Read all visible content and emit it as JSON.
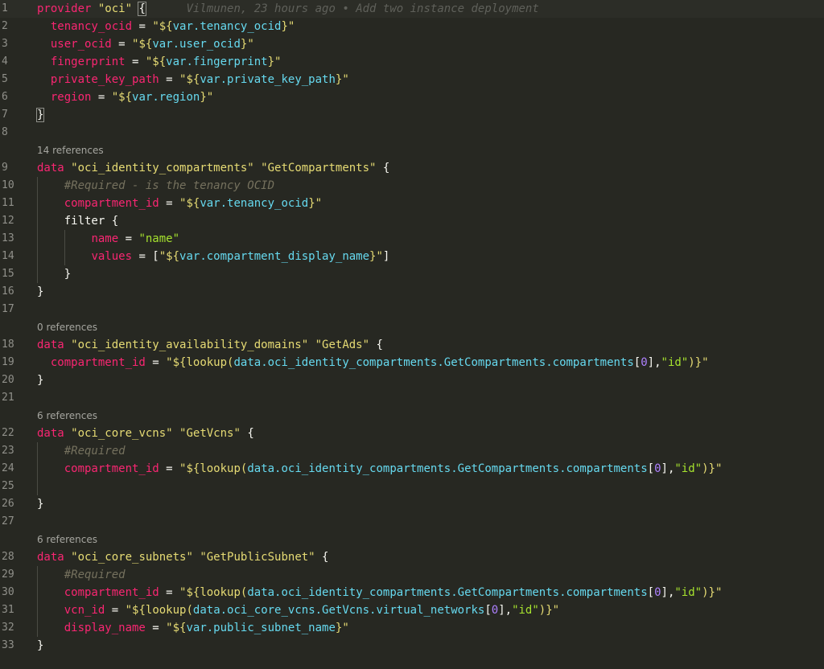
{
  "editor": {
    "blame": "Vilmunen, 23 hours ago • Add two instance deployment",
    "lines": [
      {
        "n": "1",
        "t": [
          [
            "kw",
            "provider"
          ],
          [
            "plain",
            " "
          ],
          [
            "str",
            "\"oci\""
          ],
          [
            "plain",
            " "
          ],
          [
            "match",
            "{"
          ]
        ]
      },
      {
        "n": "2",
        "t": [
          [
            "plain",
            "  "
          ],
          [
            "attr",
            "tenancy_ocid"
          ],
          [
            "plain",
            " = "
          ],
          [
            "str",
            "\"${"
          ],
          [
            "var",
            "var.tenancy_ocid"
          ],
          [
            "str",
            "}\""
          ]
        ]
      },
      {
        "n": "3",
        "t": [
          [
            "plain",
            "  "
          ],
          [
            "attr",
            "user_ocid"
          ],
          [
            "plain",
            " = "
          ],
          [
            "str",
            "\"${"
          ],
          [
            "var",
            "var.user_ocid"
          ],
          [
            "str",
            "}\""
          ]
        ]
      },
      {
        "n": "4",
        "t": [
          [
            "plain",
            "  "
          ],
          [
            "attr",
            "fingerprint"
          ],
          [
            "plain",
            " = "
          ],
          [
            "str",
            "\"${"
          ],
          [
            "var",
            "var.fingerprint"
          ],
          [
            "str",
            "}\""
          ]
        ]
      },
      {
        "n": "5",
        "t": [
          [
            "plain",
            "  "
          ],
          [
            "attr",
            "private_key_path"
          ],
          [
            "plain",
            " = "
          ],
          [
            "str",
            "\"${"
          ],
          [
            "var",
            "var.private_key_path"
          ],
          [
            "str",
            "}\""
          ]
        ]
      },
      {
        "n": "6",
        "t": [
          [
            "plain",
            "  "
          ],
          [
            "attr",
            "region"
          ],
          [
            "plain",
            " = "
          ],
          [
            "str",
            "\"${"
          ],
          [
            "var",
            "var.region"
          ],
          [
            "str",
            "}\""
          ]
        ]
      },
      {
        "n": "7",
        "t": [
          [
            "match",
            "}"
          ]
        ]
      },
      {
        "n": "8",
        "t": []
      },
      {
        "n": "9",
        "t": [
          [
            "kw",
            "data"
          ],
          [
            "plain",
            " "
          ],
          [
            "str",
            "\"oci_identity_compartments\""
          ],
          [
            "plain",
            " "
          ],
          [
            "str",
            "\"GetCompartments\""
          ],
          [
            "plain",
            " {"
          ]
        ]
      },
      {
        "n": "10",
        "t": [
          [
            "plain",
            "    "
          ],
          [
            "cmt",
            "#Required - is the tenancy OCID"
          ]
        ]
      },
      {
        "n": "11",
        "t": [
          [
            "plain",
            "    "
          ],
          [
            "attr",
            "compartment_id"
          ],
          [
            "plain",
            " = "
          ],
          [
            "str",
            "\"${"
          ],
          [
            "var",
            "var.tenancy_ocid"
          ],
          [
            "str",
            "}\""
          ]
        ]
      },
      {
        "n": "12",
        "t": [
          [
            "plain",
            "    filter {"
          ]
        ]
      },
      {
        "n": "13",
        "t": [
          [
            "plain",
            "        "
          ],
          [
            "attr",
            "name"
          ],
          [
            "plain",
            " = "
          ],
          [
            "strc",
            "\"name\""
          ]
        ]
      },
      {
        "n": "14",
        "t": [
          [
            "plain",
            "        "
          ],
          [
            "attr",
            "values"
          ],
          [
            "plain",
            " = ["
          ],
          [
            "str",
            "\"${"
          ],
          [
            "var",
            "var.compartment_display_name"
          ],
          [
            "str",
            "}\""
          ],
          [
            "plain",
            "]"
          ]
        ]
      },
      {
        "n": "15",
        "t": [
          [
            "plain",
            "    }"
          ]
        ]
      },
      {
        "n": "16",
        "t": [
          [
            "plain",
            "}"
          ]
        ]
      },
      {
        "n": "17",
        "t": []
      },
      {
        "n": "18",
        "t": [
          [
            "kw",
            "data"
          ],
          [
            "plain",
            " "
          ],
          [
            "str",
            "\"oci_identity_availability_domains\""
          ],
          [
            "plain",
            " "
          ],
          [
            "str",
            "\"GetAds\""
          ],
          [
            "plain",
            " {"
          ]
        ]
      },
      {
        "n": "19",
        "t": [
          [
            "plain",
            "  "
          ],
          [
            "attr",
            "compartment_id"
          ],
          [
            "plain",
            " = "
          ],
          [
            "str",
            "\"${"
          ],
          [
            "fn",
            "lookup("
          ],
          [
            "var",
            "data.oci_identity_compartments.GetCompartments.compartments"
          ],
          [
            "plain",
            "["
          ],
          [
            "num",
            "0"
          ],
          [
            "plain",
            "],"
          ],
          [
            "strc",
            "\"id\""
          ],
          [
            "fn",
            ")"
          ],
          [
            "str",
            "}\""
          ]
        ]
      },
      {
        "n": "20",
        "t": [
          [
            "plain",
            "}"
          ]
        ]
      },
      {
        "n": "21",
        "t": []
      },
      {
        "n": "22",
        "t": [
          [
            "kw",
            "data"
          ],
          [
            "plain",
            " "
          ],
          [
            "str",
            "\"oci_core_vcns\""
          ],
          [
            "plain",
            " "
          ],
          [
            "str",
            "\"GetVcns\""
          ],
          [
            "plain",
            " {"
          ]
        ]
      },
      {
        "n": "23",
        "t": [
          [
            "plain",
            "    "
          ],
          [
            "cmt",
            "#Required"
          ]
        ]
      },
      {
        "n": "24",
        "t": [
          [
            "plain",
            "    "
          ],
          [
            "attr",
            "compartment_id"
          ],
          [
            "plain",
            " = "
          ],
          [
            "str",
            "\"${"
          ],
          [
            "fn",
            "lookup("
          ],
          [
            "var",
            "data.oci_identity_compartments.GetCompartments.compartments"
          ],
          [
            "plain",
            "["
          ],
          [
            "num",
            "0"
          ],
          [
            "plain",
            "],"
          ],
          [
            "strc",
            "\"id\""
          ],
          [
            "fn",
            ")"
          ],
          [
            "str",
            "}\""
          ]
        ]
      },
      {
        "n": "25",
        "t": []
      },
      {
        "n": "26",
        "t": [
          [
            "plain",
            "}"
          ]
        ]
      },
      {
        "n": "27",
        "t": []
      },
      {
        "n": "28",
        "t": [
          [
            "kw",
            "data"
          ],
          [
            "plain",
            " "
          ],
          [
            "str",
            "\"oci_core_subnets\""
          ],
          [
            "plain",
            " "
          ],
          [
            "str",
            "\"GetPublicSubnet\""
          ],
          [
            "plain",
            " {"
          ]
        ]
      },
      {
        "n": "29",
        "t": [
          [
            "plain",
            "    "
          ],
          [
            "cmt",
            "#Required"
          ]
        ]
      },
      {
        "n": "30",
        "t": [
          [
            "plain",
            "    "
          ],
          [
            "attr",
            "compartment_id"
          ],
          [
            "plain",
            " = "
          ],
          [
            "str",
            "\"${"
          ],
          [
            "fn",
            "lookup("
          ],
          [
            "var",
            "data.oci_identity_compartments.GetCompartments.compartments"
          ],
          [
            "plain",
            "["
          ],
          [
            "num",
            "0"
          ],
          [
            "plain",
            "],"
          ],
          [
            "strc",
            "\"id\""
          ],
          [
            "fn",
            ")"
          ],
          [
            "str",
            "}\""
          ]
        ]
      },
      {
        "n": "31",
        "t": [
          [
            "plain",
            "    "
          ],
          [
            "attr",
            "vcn_id"
          ],
          [
            "plain",
            " = "
          ],
          [
            "str",
            "\"${"
          ],
          [
            "fn",
            "lookup("
          ],
          [
            "var",
            "data.oci_core_vcns.GetVcns.virtual_networks"
          ],
          [
            "plain",
            "["
          ],
          [
            "num",
            "0"
          ],
          [
            "plain",
            "],"
          ],
          [
            "strc",
            "\"id\""
          ],
          [
            "fn",
            ")"
          ],
          [
            "str",
            "}\""
          ]
        ]
      },
      {
        "n": "32",
        "t": [
          [
            "plain",
            "    "
          ],
          [
            "attr",
            "display_name"
          ],
          [
            "plain",
            " = "
          ],
          [
            "str",
            "\"${"
          ],
          [
            "var",
            "var.public_subnet_name"
          ],
          [
            "str",
            "}\""
          ]
        ]
      },
      {
        "n": "33",
        "t": [
          [
            "plain",
            "}"
          ]
        ]
      }
    ],
    "codelens": [
      {
        "before": "9",
        "label": "14 references"
      },
      {
        "before": "18",
        "label": "0 references"
      },
      {
        "before": "22",
        "label": "6 references"
      },
      {
        "before": "28",
        "label": "6 references"
      }
    ]
  }
}
